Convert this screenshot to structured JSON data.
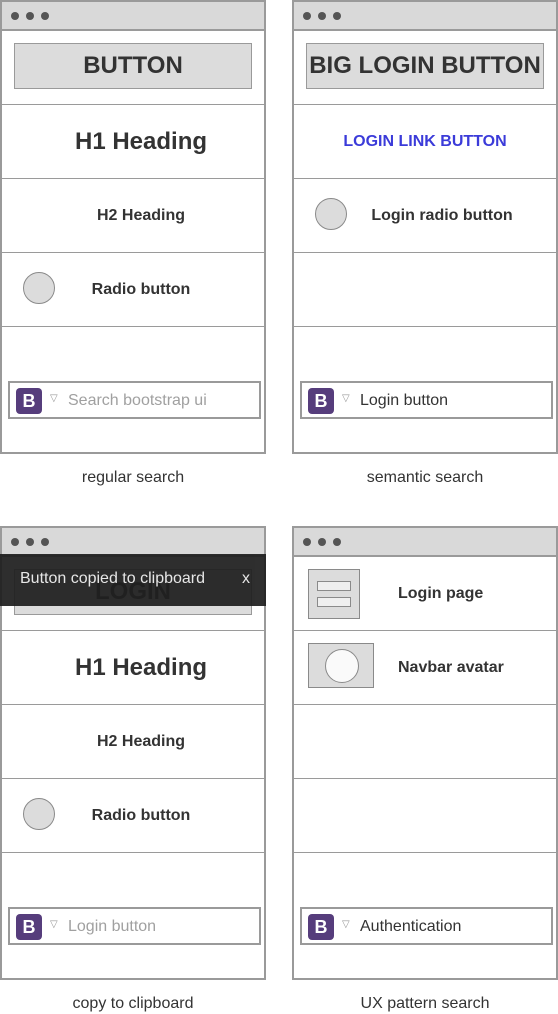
{
  "panels": {
    "regular": {
      "caption": "regular search",
      "button_label": "BUTTON",
      "h1": "H1 Heading",
      "h2": "H2 Heading",
      "radio_label": "Radio button",
      "search_logo": "B",
      "search_placeholder": "Search bootstrap ui"
    },
    "semantic": {
      "caption": "semantic search",
      "button_label": "BIG LOGIN BUTTON",
      "link_label": "LOGIN LINK BUTTON",
      "radio_label": "Login radio button",
      "search_logo": "B",
      "search_value": "Login button"
    },
    "clipboard": {
      "caption": "copy to clipboard",
      "button_label": "LOGIN",
      "toast_text": "Button copied to clipboard",
      "toast_close": "x",
      "h1": "H1 Heading",
      "h2": "H2 Heading",
      "radio_label": "Radio button",
      "search_logo": "B",
      "search_value": "Login button"
    },
    "ux": {
      "caption": "UX pattern search",
      "items": [
        {
          "label": "Login page",
          "icon": "login-page-thumbnail"
        },
        {
          "label": "Navbar avatar",
          "icon": "navbar-avatar-thumbnail"
        }
      ],
      "search_logo": "B",
      "search_value": "Authentication"
    }
  },
  "colors": {
    "bootstrap_purple": "#563d7c",
    "link_blue": "#3b3bd9",
    "placeholder_gray": "#a0a0a0"
  }
}
